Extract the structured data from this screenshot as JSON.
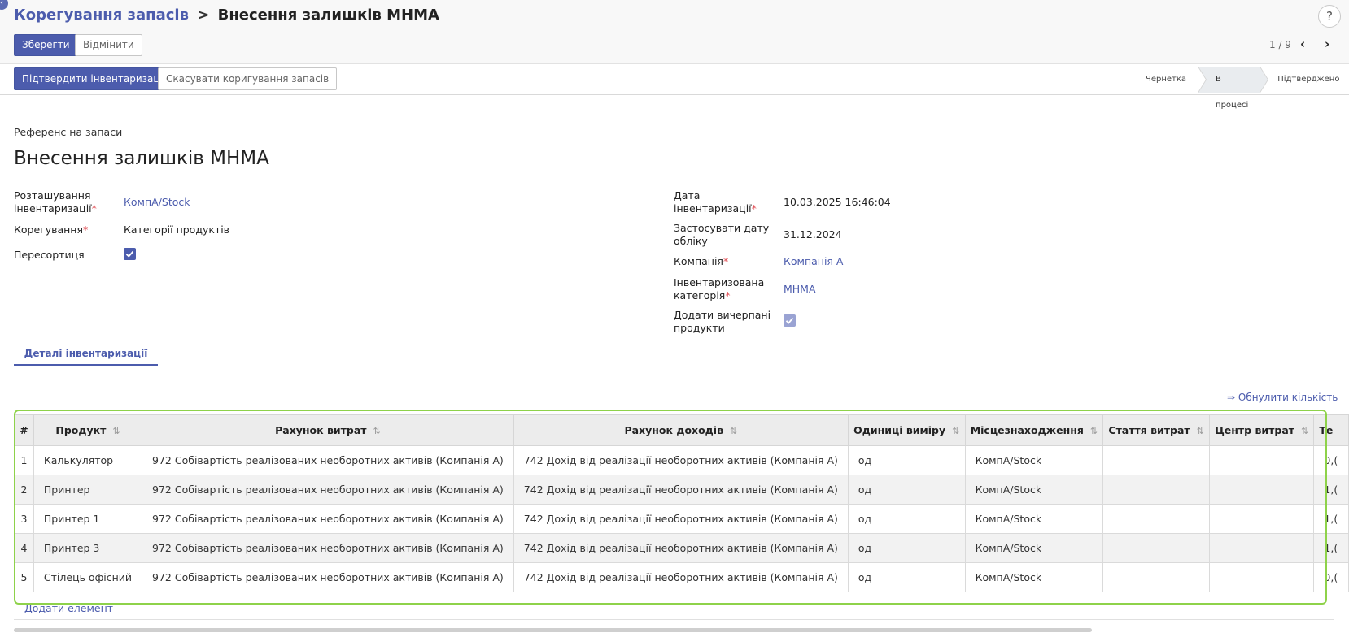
{
  "breadcrumb": {
    "parent": "Корегування запасів",
    "separator": ">",
    "current": "Внесення залишків МНМА"
  },
  "toolbar": {
    "save_label": "Зберегти",
    "discard_label": "Відмінити",
    "help_label": "?"
  },
  "pager": {
    "text": "1 / 9",
    "prev": "‹",
    "next": "›"
  },
  "actions": {
    "confirm_label": "Підтвердити інвентаризацію",
    "cancel_label": "Скасувати коригування запасів"
  },
  "status": {
    "steps": [
      "Чернетка",
      "В процесі",
      "Підтверджено"
    ],
    "active": "В процесі"
  },
  "form": {
    "ref_label": "Референс на запаси",
    "title": "Внесення залишків МНМА",
    "left": {
      "location_label_1": "Розташування",
      "location_label_2": "інвентаризації",
      "location_value": "КомпА/Stock",
      "adjustment_label": "Корегування",
      "adjustment_value": "Категорії продуктів",
      "resort_label": "Пересортиця",
      "resort_checked": true
    },
    "right": {
      "date_label_1": "Дата",
      "date_label_2": "інвентаризації",
      "date_value": "10.03.2025 16:46:04",
      "accounting_label_1": "Застосувати дату",
      "accounting_label_2": "обліку",
      "accounting_value": "31.12.2024",
      "company_label": "Компанія",
      "company_value": "Компанія А",
      "category_label_1": "Інвентаризована",
      "category_label_2": "категорія",
      "category_value": "МНМА",
      "exhausted_label_1": "Додати вичерпані",
      "exhausted_label_2": "продукти",
      "exhausted_checked": true
    },
    "required_mark": "*"
  },
  "tabs": {
    "details_label": "Деталі інвентаризації"
  },
  "reset_quantities_label": "⇒ Обнулити кількість",
  "table": {
    "headers": {
      "index": "#",
      "product": "Продукт",
      "expense_account": "Рахунок витрат",
      "income_account": "Рахунок доходів",
      "uom": "Одиниці виміру",
      "location": "Місцезнаходження",
      "cost_item": "Стаття витрат",
      "cost_center": "Центр витрат",
      "theoretical_partial": "Те"
    },
    "rows": [
      {
        "index": "1",
        "product": "Калькулятор",
        "expense_account": "972 Собівартість реалізованих необоротних активів (Компанія А)",
        "income_account": "742 Дохід від реалізації необоротних активів (Компанія А)",
        "uom": "од",
        "location": "КомпА/Stock",
        "cost_item": "",
        "cost_center": "",
        "theoretical_partial": "0,("
      },
      {
        "index": "2",
        "product": "Принтер",
        "expense_account": "972 Собівартість реалізованих необоротних активів (Компанія А)",
        "income_account": "742 Дохід від реалізації необоротних активів (Компанія А)",
        "uom": "од",
        "location": "КомпА/Stock",
        "cost_item": "",
        "cost_center": "",
        "theoretical_partial": "1,("
      },
      {
        "index": "3",
        "product": "Принтер 1",
        "expense_account": "972 Собівартість реалізованих необоротних активів (Компанія А)",
        "income_account": "742 Дохід від реалізації необоротних активів (Компанія А)",
        "uom": "од",
        "location": "КомпА/Stock",
        "cost_item": "",
        "cost_center": "",
        "theoretical_partial": "1,("
      },
      {
        "index": "4",
        "product": "Принтер 3",
        "expense_account": "972 Собівартість реалізованих необоротних активів (Компанія А)",
        "income_account": "742 Дохід від реалізації необоротних активів (Компанія А)",
        "uom": "од",
        "location": "КомпА/Stock",
        "cost_item": "",
        "cost_center": "",
        "theoretical_partial": "1,("
      },
      {
        "index": "5",
        "product": "Стілець офісний",
        "expense_account": "972 Собівартість реалізованих необоротних активів (Компанія А)",
        "income_account": "742 Дохід від реалізації необоротних активів (Компанія А)",
        "uom": "од",
        "location": "КомпА/Stock",
        "cost_item": "",
        "cost_center": "",
        "theoretical_partial": "0,("
      }
    ],
    "add_line_label": "Додати елемент"
  },
  "colors": {
    "accent": "#4c5cad",
    "required": "#e0484f",
    "highlight": "#8ed24a"
  }
}
